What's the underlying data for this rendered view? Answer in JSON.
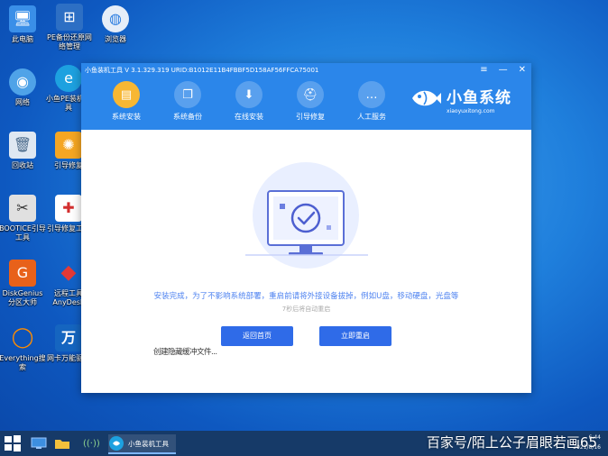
{
  "desktop": {
    "icons": [
      {
        "label": "此电脑"
      },
      {
        "label": "PE备份还原网络管理"
      },
      {
        "label": "浏览器"
      },
      {
        "label": "网络"
      },
      {
        "label": "小鱼PE装机工具"
      },
      {
        "label": "回收站"
      },
      {
        "label": "引导修复"
      },
      {
        "label": "BOOTICE引导工具"
      },
      {
        "label": "引导修复工具"
      },
      {
        "label": "DiskGenius分区大师"
      },
      {
        "label": "远程工具AnyDesk"
      },
      {
        "label": "Everything搜索"
      },
      {
        "label": "网卡万能驱动"
      }
    ]
  },
  "app": {
    "title": "小鱼装机工具 V 3.1.329.319 URID:B1012E11B4FBBF5D158AF56FFCA75001",
    "controls": {
      "menu": "≡",
      "minimize": "—",
      "close": "✕"
    },
    "nav": [
      {
        "label": "系统安装",
        "active": true
      },
      {
        "label": "系统备份",
        "active": false
      },
      {
        "label": "在线安装",
        "active": false
      },
      {
        "label": "引导修复",
        "active": false
      },
      {
        "label": "人工服务",
        "active": false
      }
    ],
    "brand": {
      "name": "小鱼系统",
      "url": "xiaoyuxitong.com"
    },
    "content": {
      "message": "安装完成，为了不影响系统部署，重启前请将外接设备拔掉，例如U盘，移动硬盘，光盘等",
      "countdown": "7秒后将自动重启",
      "home_button": "返回首页",
      "restart_button": "立即重启",
      "overlay_text": "创建隐藏缓冲文件..."
    }
  },
  "taskbar": {
    "running_app": "小鱼装机工具",
    "tray": {
      "time": "6:44",
      "date": "2021/8/16"
    }
  },
  "watermark": "百家号/陌上公子眉眼若画65"
}
